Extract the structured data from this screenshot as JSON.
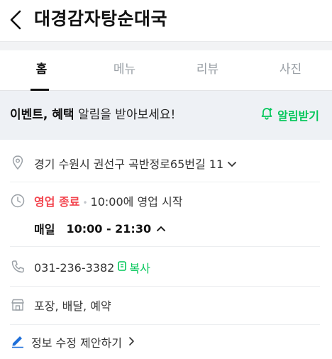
{
  "header": {
    "title": "대경감자탕순대국"
  },
  "tabs": [
    {
      "label": "홈"
    },
    {
      "label": "메뉴"
    },
    {
      "label": "리뷰"
    },
    {
      "label": "사진"
    }
  ],
  "event": {
    "strong_text": "이벤트, 혜택",
    "text": " 알림을 받아보세요!",
    "button_label": "알림받기"
  },
  "address": {
    "text": "경기 수원시 권선구 곡반정로65번길 11"
  },
  "hours": {
    "status": "영업 종료",
    "next_open": "10:00에 영업 시작",
    "daily_label": "매일",
    "daily_hours": "10:00 - 21:30"
  },
  "phone": {
    "number": "031-236-3382",
    "copy_label": "복사"
  },
  "services": {
    "text": "포장, 배달, 예약"
  },
  "suggest": {
    "label": "정보 수정 제안하기"
  },
  "colors": {
    "accent_green": "#03c75a",
    "closed_red": "#f3454f",
    "event_bg": "#eef1f5"
  }
}
